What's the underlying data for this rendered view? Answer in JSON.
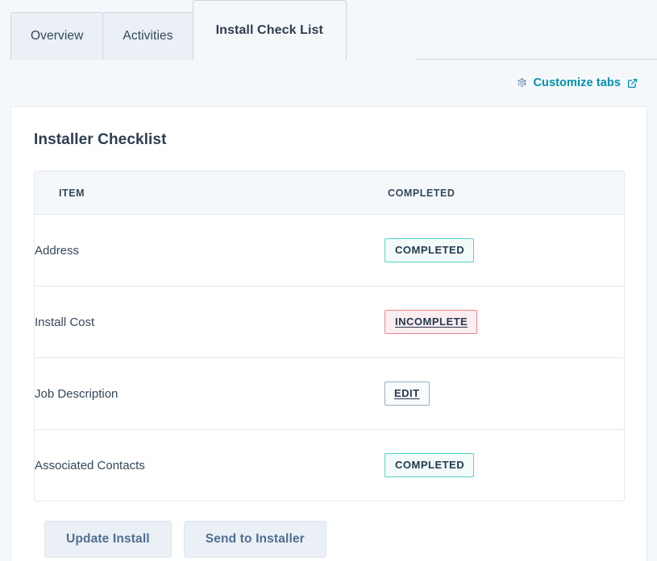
{
  "tabs": {
    "items": [
      {
        "label": "Overview",
        "active": false
      },
      {
        "label": "Activities",
        "active": false
      },
      {
        "label": "Install Check List",
        "active": true
      }
    ]
  },
  "customize": {
    "label": "Customize tabs",
    "gear_icon": "gear-icon",
    "external_icon": "external-link-icon"
  },
  "card": {
    "title": "Installer Checklist",
    "table": {
      "headers": [
        "ITEM",
        "COMPLETED"
      ],
      "rows": [
        {
          "item": "Address",
          "status": "COMPLETED",
          "status_type": "completed"
        },
        {
          "item": "Install Cost",
          "status": "INCOMPLETE",
          "status_type": "incomplete"
        },
        {
          "item": "Job Description",
          "status": "EDIT",
          "status_type": "edit"
        },
        {
          "item": "Associated Contacts",
          "status": "COMPLETED",
          "status_type": "completed"
        }
      ]
    },
    "actions": [
      {
        "label": "Update Install"
      },
      {
        "label": "Send to Installer"
      }
    ]
  },
  "colors": {
    "page_background": "#f5f8fa",
    "tab_inactive_background": "#eaf0f6",
    "tab_border": "#cbd6e2",
    "text_primary": "#33475b",
    "heading": "#2d3e50",
    "link_teal": "#0091ae",
    "badge_completed_border": "#51d4c3",
    "badge_completed_background": "#f2fbfa",
    "badge_incomplete_border": "#f2808f",
    "badge_incomplete_background": "#fbeef0",
    "badge_edit_border": "#9aadc2",
    "button_background": "#eaf0f6",
    "button_text": "#506e91"
  }
}
